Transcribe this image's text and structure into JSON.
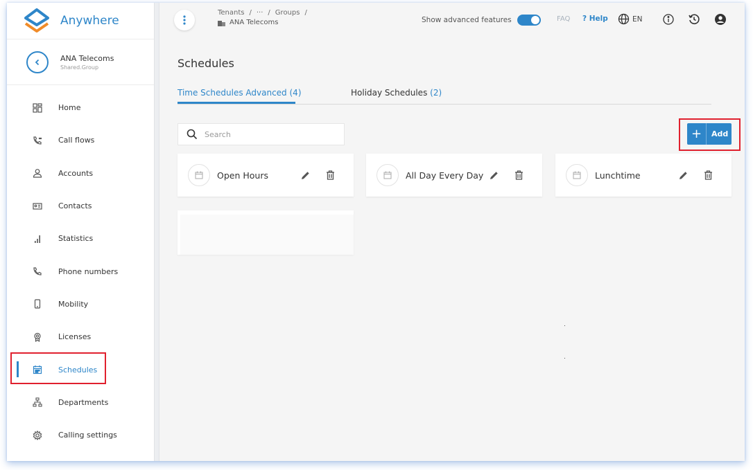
{
  "app": {
    "name": "Anywhere"
  },
  "tenant": {
    "name": "ANA Telecoms",
    "subtitle": "Shared.Group"
  },
  "sidebar": {
    "items": [
      {
        "label": "Home",
        "icon": "dashboard-icon"
      },
      {
        "label": "Call flows",
        "icon": "call-flows-icon"
      },
      {
        "label": "Accounts",
        "icon": "user-icon"
      },
      {
        "label": "Contacts",
        "icon": "contact-card-icon"
      },
      {
        "label": "Statistics",
        "icon": "bar-chart-icon"
      },
      {
        "label": "Phone numbers",
        "icon": "phone-icon"
      },
      {
        "label": "Mobility",
        "icon": "mobile-icon"
      },
      {
        "label": "Licenses",
        "icon": "license-icon"
      },
      {
        "label": "Schedules",
        "icon": "calendar-icon",
        "active": true
      },
      {
        "label": "Departments",
        "icon": "org-chart-icon"
      },
      {
        "label": "Calling settings",
        "icon": "gear-icon"
      }
    ]
  },
  "header": {
    "breadcrumb": {
      "tenants": "Tenants",
      "sep": "/",
      "ellipsis": "···",
      "groups": "Groups",
      "current": "ANA Telecoms"
    },
    "advanced_label": "Show advanced features",
    "advanced_on": true,
    "faq": "FAQ",
    "help": "? Help",
    "language": "EN"
  },
  "page": {
    "title": "Schedules",
    "tabs": [
      {
        "label": "Time Schedules Advanced",
        "count": "(4)",
        "active": true
      },
      {
        "label": "Holiday Schedules",
        "count": "(2)",
        "active": false
      }
    ],
    "search_placeholder": "Search",
    "add_label": "Add",
    "add_plus": "+"
  },
  "schedules": [
    {
      "name": "Open Hours"
    },
    {
      "name": "All Day Every Day"
    },
    {
      "name": "Lunchtime"
    }
  ],
  "colors": {
    "accent": "#2e86c9",
    "highlight": "#e0202e"
  }
}
